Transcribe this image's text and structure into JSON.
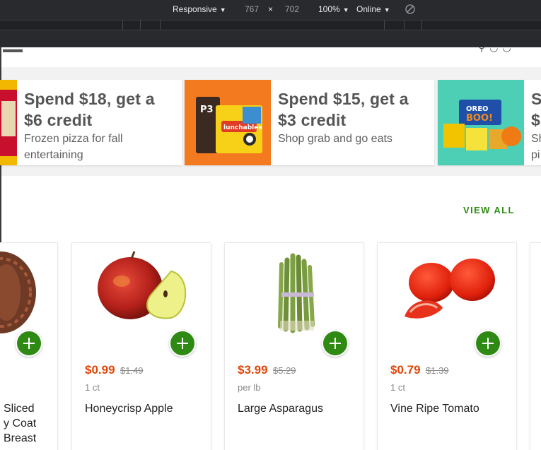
{
  "devtools": {
    "device": "Responsive",
    "width": "767",
    "times": "×",
    "height": "702",
    "zoom": "100%",
    "network": "Online",
    "caret": "▼"
  },
  "promos": [
    {
      "title_line1": "Spend $18, get a",
      "title_line2": "$6 credit",
      "subtitle_line1": "Frozen pizza for fall",
      "subtitle_line2": "entertaining",
      "image_bg": "#f2b700"
    },
    {
      "title_line1": "Spend $15, get a",
      "title_line2": "$3 credit",
      "subtitle_line1": "Shop grab and go eats",
      "subtitle_line2": "",
      "image_bg": "#f47a1f"
    },
    {
      "title_line1": "S",
      "title_line2": "$",
      "subtitle_line1": "Sh",
      "subtitle_line2": "pi",
      "image_bg": "#4ccfb4"
    }
  ],
  "section": {
    "view_all": "VIEW ALL"
  },
  "products": [
    {
      "name_line1": "Sliced",
      "name_line2": "y Coat",
      "name_line3": "Breast",
      "price": "",
      "orig_price": "",
      "unit": ""
    },
    {
      "name_line1": "Honeycrisp Apple",
      "price": "$0.99",
      "orig_price": "$1.49",
      "unit": "1 ct"
    },
    {
      "name_line1": "Large Asparagus",
      "price": "$3.99",
      "orig_price": "$5.29",
      "unit": "per lb"
    },
    {
      "name_line1": "Vine Ripe Tomato",
      "price": "$0.79",
      "orig_price": "$1.39",
      "unit": "1 ct"
    }
  ],
  "colors": {
    "accent_green": "#2e8a13",
    "sale_red": "#e0470a"
  }
}
